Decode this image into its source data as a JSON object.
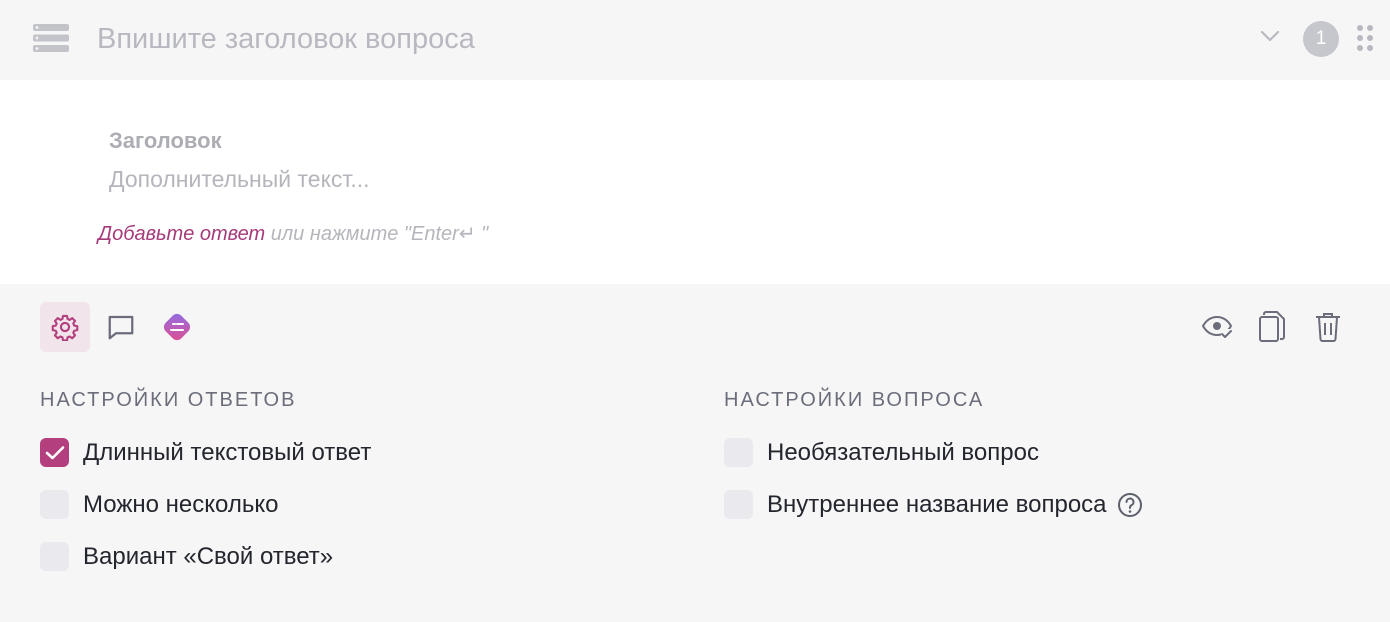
{
  "header": {
    "title_placeholder": "Впишите заголовок вопроса",
    "badge_number": "1",
    "icons": [
      "list-icon",
      "chevron-down-icon",
      "drag-handle-icon"
    ]
  },
  "question": {
    "heading": "Заголовок",
    "subtext": "Дополнительный текст...",
    "add_answer_link": "Добавьте ответ",
    "add_answer_hint": "или нажмите \"Enter↵ \""
  },
  "toolbar": {
    "left_icons": [
      "gear-icon",
      "comment-icon",
      "logic-icon"
    ],
    "right_icons": [
      "eye-check-icon",
      "copy-icon",
      "trash-icon"
    ],
    "accent_color": "#b33f7f"
  },
  "answer_settings": {
    "title": "НАСТРОЙКИ ОТВЕТОВ",
    "options": [
      {
        "label": "Длинный текстовый ответ",
        "checked": true
      },
      {
        "label": "Можно несколько",
        "checked": false
      },
      {
        "label": "Вариант «Свой ответ»",
        "checked": false
      }
    ]
  },
  "question_settings": {
    "title": "НАСТРОЙКИ ВОПРОСА",
    "options": [
      {
        "label": "Необязательный вопрос",
        "checked": false
      },
      {
        "label": "Внутреннее название вопроса",
        "checked": false,
        "help": true
      }
    ]
  }
}
